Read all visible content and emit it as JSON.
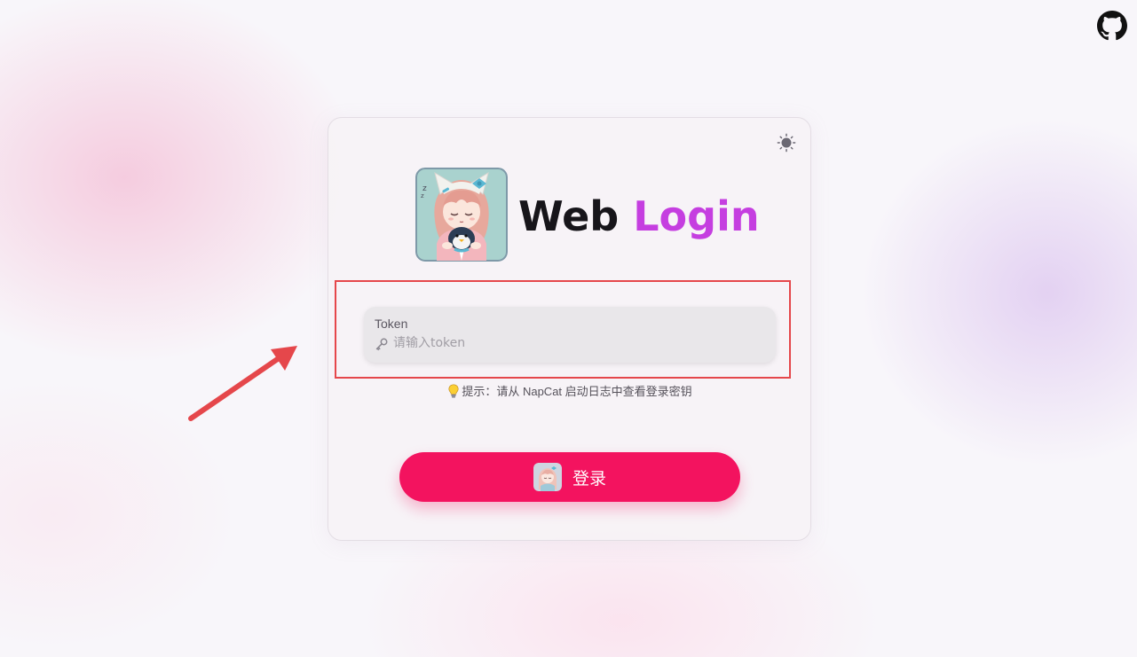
{
  "header": {
    "github_icon": "github-icon"
  },
  "login_card": {
    "theme_toggle_icon": "sun-icon",
    "logo_icon": "anime-avatar-logo",
    "title_part1": "Web",
    "title_part2": "Login",
    "token_field": {
      "label": "Token",
      "placeholder": "请输入token",
      "value": "",
      "icon": "key-icon"
    },
    "hint": {
      "icon": "lightbulb-icon",
      "text": "提示：请从 NapCat 启动日志中查看登录密钥"
    },
    "login_button": {
      "label": "登录",
      "icon": "anime-avatar-icon"
    }
  },
  "annotation": {
    "arrow_color": "#e5474b",
    "box_color": "#e5474b"
  },
  "colors": {
    "accent": "#f3135f",
    "title_accent": "#c53ee0"
  }
}
